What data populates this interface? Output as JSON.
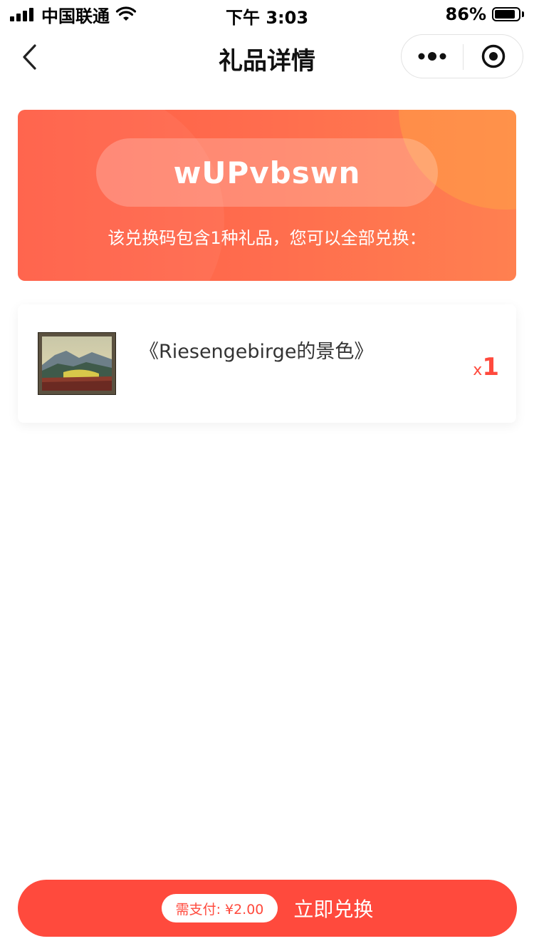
{
  "status_bar": {
    "carrier": "中国联通",
    "time": "下午 3:03",
    "battery_percent": "86%",
    "battery_level": 0.86
  },
  "nav": {
    "title": "礼品详情"
  },
  "hero": {
    "code": "wUPvbswn",
    "description": "该兑换码包含1种礼品，您可以全部兑换："
  },
  "gifts": [
    {
      "name": "《Riesengebirge的景色》",
      "qty_prefix": "x",
      "qty": "1"
    }
  ],
  "action": {
    "price_text": "需支付: ¥2.00",
    "button_label": "立即兑换"
  },
  "colors": {
    "accent": "#ff4a3d",
    "hero_start": "#ff5d45",
    "hero_end": "#ff8050"
  }
}
